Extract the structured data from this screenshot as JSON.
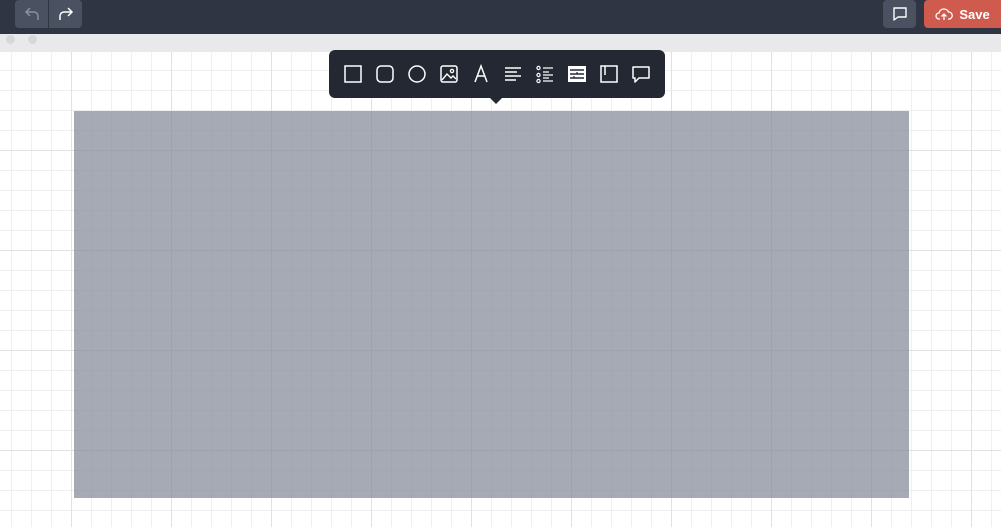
{
  "topbar": {
    "undo_icon": "undo-arrow-icon",
    "redo_icon": "redo-arrow-icon",
    "comments_icon": "comment-icon",
    "save_label": "Save",
    "save_icon": "cloud-upload-icon",
    "save_color": "#cf5b4e"
  },
  "toolbar": {
    "tools": [
      {
        "name": "rectangle",
        "icon": "rectangle-icon"
      },
      {
        "name": "rounded-rectangle",
        "icon": "rounded-rectangle-icon"
      },
      {
        "name": "circle",
        "icon": "circle-icon"
      },
      {
        "name": "image",
        "icon": "image-icon"
      },
      {
        "name": "text",
        "icon": "text-icon"
      },
      {
        "name": "paragraph",
        "icon": "align-left-icon"
      },
      {
        "name": "list",
        "icon": "list-icon"
      },
      {
        "name": "table",
        "icon": "table-icon"
      },
      {
        "name": "panel",
        "icon": "panel-icon"
      },
      {
        "name": "comment-bubble",
        "icon": "speech-bubble-icon"
      }
    ]
  },
  "canvas": {
    "grid": true,
    "selected_shape_color": "#8a909e"
  }
}
